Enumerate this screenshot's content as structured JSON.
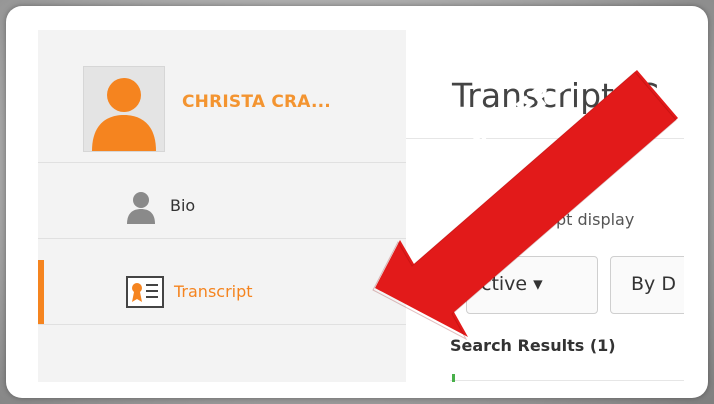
{
  "user": {
    "name": "CHRISTA CRA..."
  },
  "nav": {
    "bio_label": "Bio",
    "transcript_label": "Transcript"
  },
  "main": {
    "title": "Transcript: C",
    "description_partial": "pt display",
    "filters": {
      "active_label": "ctive ▾",
      "date_label": "By D"
    },
    "results_label": "Search Results (1)"
  },
  "annotation": {
    "callout_text": "CLICK HERE"
  },
  "colors": {
    "accent": "#f5841f",
    "arrow_red": "#e21a1a",
    "name": "#f39430"
  },
  "icons": [
    "user-avatar-icon",
    "bio-person-icon",
    "transcript-certificate-icon",
    "dropdown-caret-icon"
  ]
}
